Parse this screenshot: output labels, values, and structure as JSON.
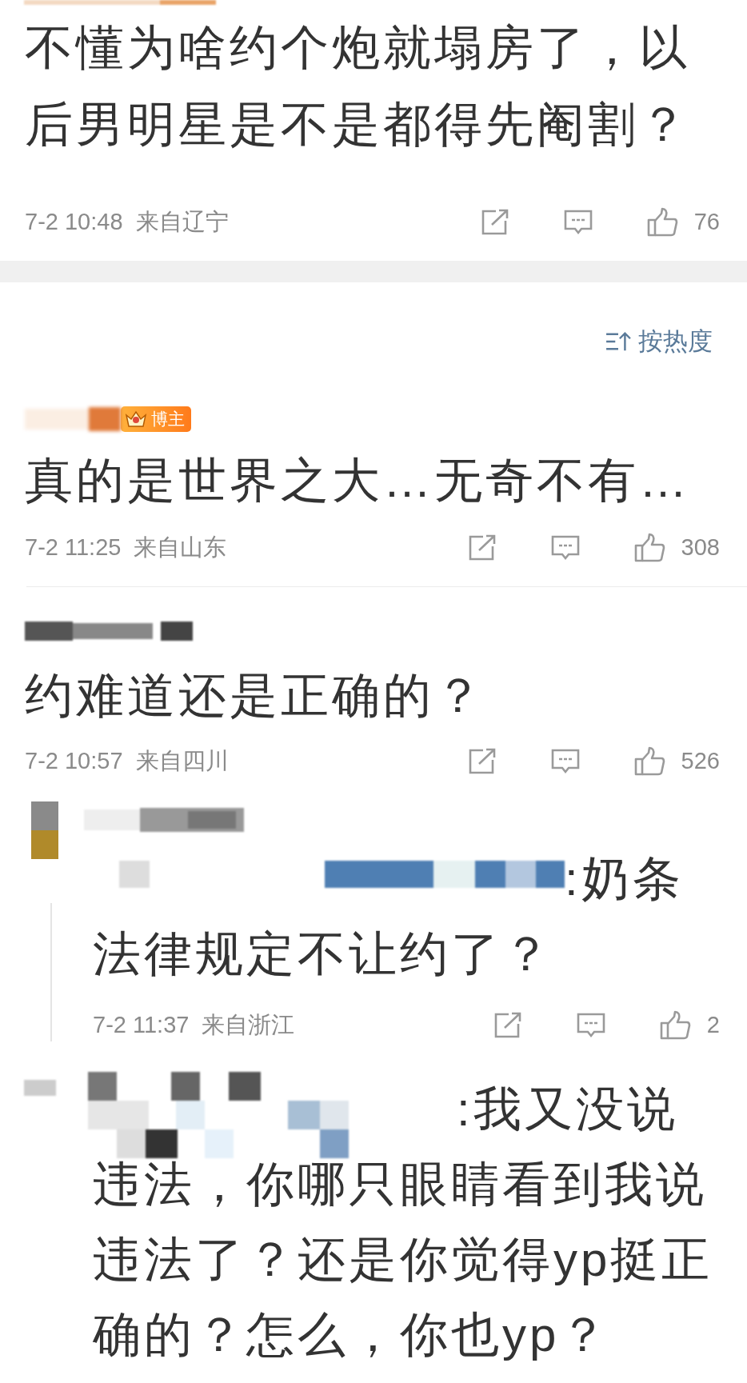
{
  "top_comment": {
    "text": "不懂为啥约个炮就塌房了，以后男明星是不是都得先阉割？",
    "time": "7-2 10:48",
    "location": "来自辽宁",
    "likes": "76"
  },
  "sort": {
    "label": "按热度"
  },
  "comments": [
    {
      "badge": "博主",
      "text": "真的是世界之大…无奇不有…",
      "time": "7-2 11:25",
      "location": "来自山东",
      "likes": "308"
    },
    {
      "text": "约难道还是正确的？",
      "time": "7-2 10:57",
      "location": "来自四川",
      "likes": "526",
      "replies": [
        {
          "kind": "avatar",
          "lead": ":奶条",
          "text": "法律规定不让约了？",
          "time": "7-2 11:37",
          "location": "来自浙江",
          "likes": "2"
        },
        {
          "kind": "plain",
          "lead": ":我又没说",
          "text": "违法，你哪只眼睛看到我说违法了？还是你觉得yp挺正确的？怎么，你也yp？"
        }
      ]
    }
  ]
}
